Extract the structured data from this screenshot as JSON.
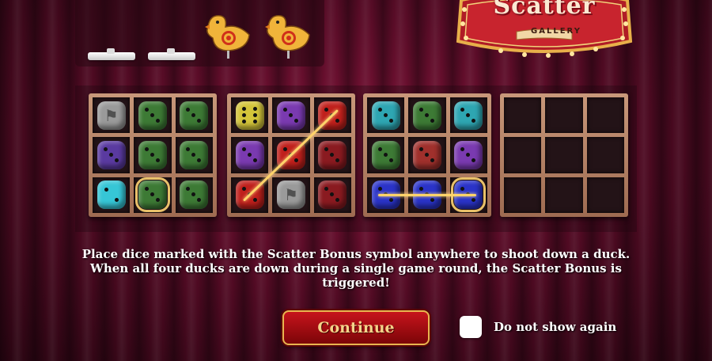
{
  "logo": {
    "title": "Scatter",
    "subtitle": "GALLERY"
  },
  "ducks": [
    {
      "state": "down"
    },
    {
      "state": "down"
    },
    {
      "state": "up"
    },
    {
      "state": "up"
    }
  ],
  "grids": [
    {
      "dice": [
        {
          "color": "#9a9a9a",
          "pips": 0,
          "scatter": true
        },
        {
          "color": "#3d7a35",
          "pips": 3
        },
        {
          "color": "#3d7a35",
          "pips": 3
        },
        {
          "color": "#5a3aa0",
          "pips": 3
        },
        {
          "color": "#3d7a35",
          "pips": 3
        },
        {
          "color": "#3d7a35",
          "pips": 3
        },
        {
          "color": "#36c6d6",
          "pips": 2
        },
        {
          "color": "#3d7a35",
          "pips": 3,
          "framed": true
        },
        {
          "color": "#3d7a35",
          "pips": 3
        }
      ],
      "lines": []
    },
    {
      "dice": [
        {
          "color": "#d3c43a",
          "pips": 6
        },
        {
          "color": "#7a3ab0",
          "pips": 3
        },
        {
          "color": "#c0201c",
          "pips": 3
        },
        {
          "color": "#7a3ab0",
          "pips": 3
        },
        {
          "color": "#c0201c",
          "pips": 3
        },
        {
          "color": "#8a1a20",
          "pips": 3
        },
        {
          "color": "#c0201c",
          "pips": 3
        },
        {
          "color": "#9a9a9a",
          "pips": 0,
          "scatter": true
        },
        {
          "color": "#8a1a20",
          "pips": 3
        }
      ],
      "lines": [
        {
          "from": 6,
          "to": 2
        }
      ]
    },
    {
      "dice": [
        {
          "color": "#2ea6b2",
          "pips": 3
        },
        {
          "color": "#3d7a35",
          "pips": 3
        },
        {
          "color": "#2ea6b2",
          "pips": 3
        },
        {
          "color": "#3d7a35",
          "pips": 3
        },
        {
          "color": "#a0302c",
          "pips": 3
        },
        {
          "color": "#7a3ab0",
          "pips": 3
        },
        {
          "color": "#2a33c8",
          "pips": 3
        },
        {
          "color": "#2a33c8",
          "pips": 3
        },
        {
          "color": "#2a33c8",
          "pips": 3,
          "framed": true
        }
      ],
      "lines": [
        {
          "from": 6,
          "to": 8
        }
      ]
    },
    {
      "dice": [
        null,
        null,
        null,
        null,
        null,
        null,
        null,
        null,
        null
      ],
      "lines": []
    }
  ],
  "message": {
    "line1": "Place dice marked with the Scatter Bonus symbol anywhere to shoot down a duck.",
    "line2": "When all four ducks are down during a single game round, the Scatter Bonus is",
    "line3": "triggered!"
  },
  "buttons": {
    "continue": "Continue"
  },
  "do_not_show": {
    "label": "Do not show again",
    "checked": false
  },
  "colors": {
    "accent": "#e9b54f",
    "button": "#c7141c",
    "line": "#ffd36a"
  }
}
